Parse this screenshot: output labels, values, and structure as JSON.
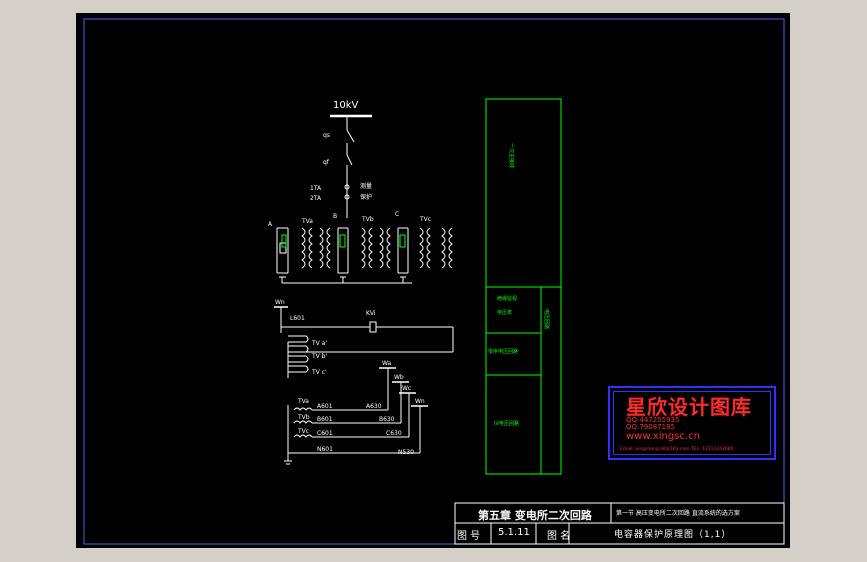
{
  "diagram": {
    "bus_label": "10kV",
    "qs_label": "qs",
    "qf_label": "qf",
    "ta1_label": "1TA",
    "ta2_label": "2TA",
    "measure_label": "测量",
    "protect_label": "保护",
    "phase_a": "A",
    "phase_b": "B",
    "phase_c": "C",
    "tva_top": "TVa",
    "tvb_top": "TVb",
    "tvc_top": "TVc",
    "wn_label": "Wn",
    "l601_label": "L601",
    "kvi_label": "KVi",
    "tva_sec": "TV a'",
    "tvb_sec": "TV b'",
    "tvc_sec": "TV c'",
    "wa_label": "Wa",
    "wb_label": "Wb",
    "wc_label": "Wc",
    "wn2_label": "Wn",
    "tva_low": "TVa",
    "tvb_low": "TVb",
    "tvc_low": "TVc",
    "a601": "A601",
    "b601": "B601",
    "c601": "C601",
    "n601": "N601",
    "a630": "A630",
    "b630": "B630",
    "c630": "C630",
    "n530": "N530"
  },
  "legend_panel": {
    "primary_circuit": "一次主接线",
    "insulation_monitor": "绝缘监视",
    "voltage_meter": "电压表",
    "voltage_circuit": "电压回路",
    "zero_seq_circuit": "零序电压回路",
    "iv_circuit": "IV电压回路"
  },
  "watermark": {
    "brand": "星欣设计图库",
    "qq1": "QQ:447255935",
    "qq2": "QQ:79087185",
    "site": "www.xingsc.cn",
    "contact": "Email: xingsheng.all@163.com   TEL: 13111242680"
  },
  "title_block": {
    "chapter": "第五章  变电所二次回路",
    "description": "第一节 高压变电所二次回路 直流系统的选方案",
    "drawing_no_label": "图 号",
    "drawing_no": "5.1.11",
    "drawing_name_label": "图 名",
    "drawing_name": "电容器保护原理图（1,1）"
  }
}
